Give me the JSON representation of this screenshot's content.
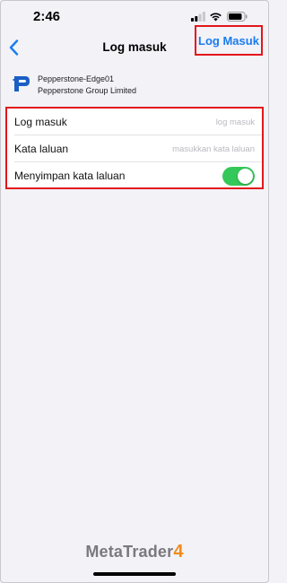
{
  "status_bar": {
    "time": "2:46"
  },
  "nav": {
    "title": "Log masuk",
    "login_button": "Log Masuk"
  },
  "server": {
    "name": "Pepperstone-Edge01",
    "company": "Pepperstone Group Limited"
  },
  "form": {
    "login_label": "Log masuk",
    "login_placeholder": "log masuk",
    "password_label": "Kata laluan",
    "password_placeholder": "masukkan kata laluan",
    "save_password_label": "Menyimpan kata laluan",
    "save_password_on": true
  },
  "footer": {
    "brand": "MetaTrader",
    "brand_version": "4"
  },
  "colors": {
    "accent": "#1a7cf0",
    "toggle_on": "#34c759",
    "highlight": "#e2161c",
    "brand_orange": "#f08c1a"
  }
}
